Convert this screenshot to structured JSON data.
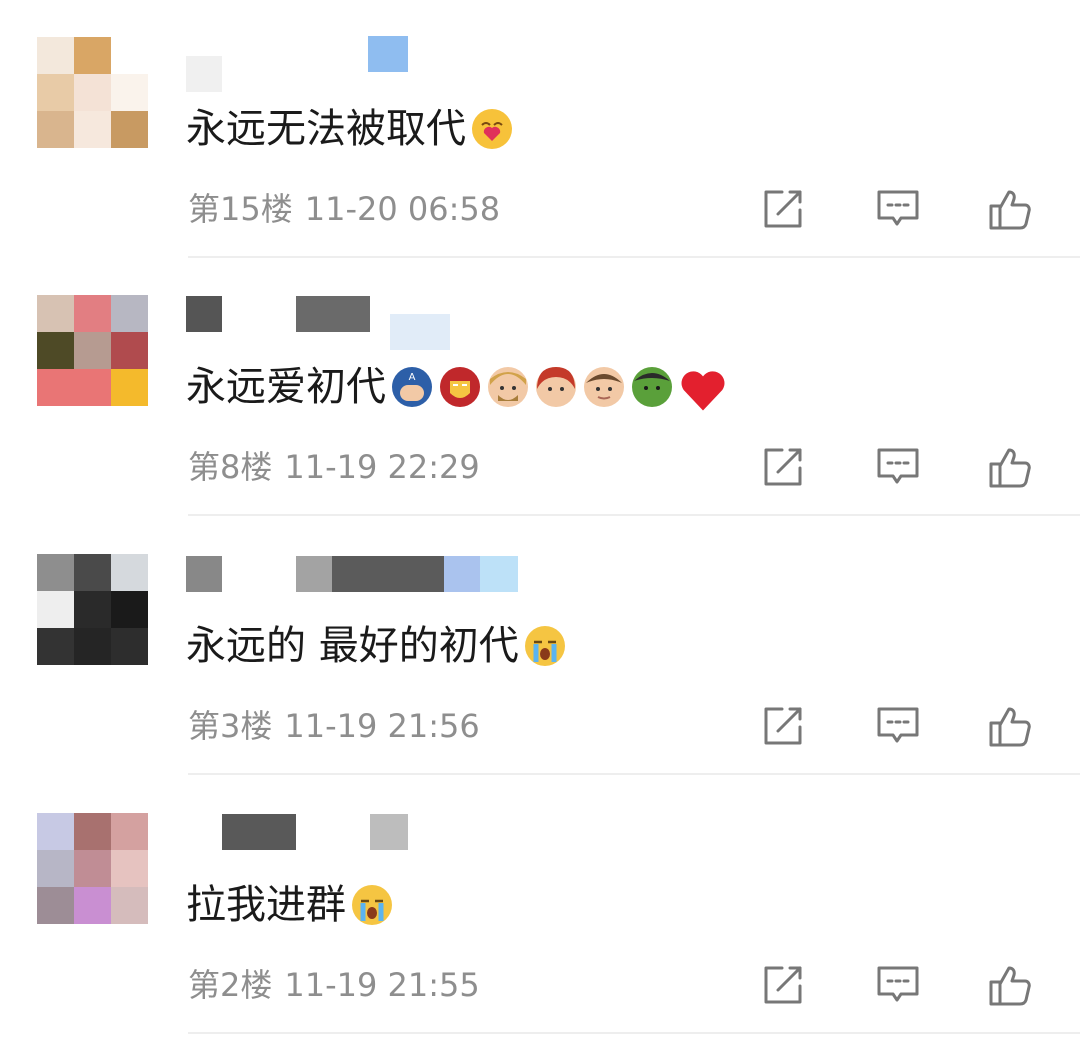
{
  "comments": [
    {
      "text": "永远无法被取代",
      "emojis": [
        "heart-hug-emoji"
      ],
      "floor": "第15楼",
      "time": "11-20 06:58",
      "avatar_colors": [
        "#f3e8dc",
        "#d9a665",
        "#ffffff",
        "#e8cba7",
        "#f4e2d6",
        "#faf3ec",
        "#d9b58e",
        "#f6e8dd",
        "#c89a62"
      ],
      "name_colors": [
        "#f0f0f0",
        "#8fbdf0"
      ]
    },
    {
      "text": "永远爱初代",
      "emojis": [
        "captain-america-emoji",
        "iron-man-emoji",
        "thor-emoji",
        "black-widow-emoji",
        "hawkeye-emoji",
        "hulk-emoji",
        "red-heart-emoji"
      ],
      "floor": "第8楼",
      "time": "11-19 22:29",
      "avatar_colors": [
        "#d7c2b3",
        "#e27e82",
        "#b7b7c2",
        "#4e4a26",
        "#b69b91",
        "#b04b4e",
        "#e97575",
        "#e97575",
        "#f4ba2c"
      ],
      "name_colors": [
        "#555555",
        "#6a6a6a",
        "#e1ecf8"
      ]
    },
    {
      "text": "永远的 最好的初代",
      "emojis": [
        "loudly-crying-emoji"
      ],
      "floor": "第3楼",
      "time": "11-19 21:56",
      "avatar_colors": [
        "#8e8e8e",
        "#4a4a4a",
        "#d5d9dd",
        "#eeeeee",
        "#2a2a2a",
        "#1a1a1a",
        "#333333",
        "#252525",
        "#2d2d2d"
      ],
      "name_colors": [
        "#888888",
        "#a3a3a3",
        "#5b5b5b",
        "#aac3ee",
        "#bde1f8"
      ]
    },
    {
      "text": "拉我进群",
      "emojis": [
        "loudly-crying-emoji"
      ],
      "floor": "第2楼",
      "time": "11-19 21:55",
      "avatar_colors": [
        "#c7c9e4",
        "#a8716f",
        "#d4a1a0",
        "#b7b6c6",
        "#c08d95",
        "#e6c3c0",
        "#9d8d96",
        "#c98fd2",
        "#d5bcbc"
      ],
      "name_colors": [
        "#595959",
        "#bdbdbd"
      ]
    }
  ],
  "actions": {
    "share_icon": "share-icon",
    "reply_icon": "comment-icon",
    "like_icon": "thumbs-up-icon"
  }
}
